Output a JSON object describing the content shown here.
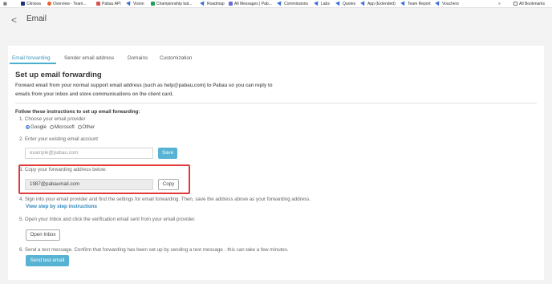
{
  "bookmarks": {
    "items": [
      {
        "label": "Clinicea",
        "icon": "clinicea-icon",
        "color": "#1e2f75"
      },
      {
        "label": "Overview - Team...",
        "icon": "overview-icon",
        "color": "#e8632b"
      },
      {
        "label": "Pabau API",
        "icon": "api-icon",
        "color": "#d9534f"
      },
      {
        "label": "Vision",
        "icon": "pin-icon",
        "color": "#3b6fd8"
      },
      {
        "label": "Championship bat...",
        "icon": "sheet-icon",
        "color": "#1e9e57"
      },
      {
        "label": "Roadmap",
        "icon": "pin-icon",
        "color": "#3b6fd8"
      },
      {
        "label": "All Messages | Pab...",
        "icon": "messages-icon",
        "color": "#6b6bd6"
      },
      {
        "label": "Commissions",
        "icon": "pin-icon",
        "color": "#3b6fd8"
      },
      {
        "label": "Labs",
        "icon": "pin-icon",
        "color": "#3b6fd8"
      },
      {
        "label": "Quotes",
        "icon": "pin-icon",
        "color": "#3b6fd8"
      },
      {
        "label": "App (Extended)",
        "icon": "pin-icon",
        "color": "#3b6fd8"
      },
      {
        "label": "Team Report",
        "icon": "pin-icon",
        "color": "#3b6fd8"
      },
      {
        "label": "Vouchers",
        "icon": "pin-icon",
        "color": "#3b6fd8"
      }
    ],
    "more_label": "»",
    "all_bookmarks_label": "All Bookmarks"
  },
  "header": {
    "back_glyph": "<",
    "title": "Email"
  },
  "tabs": [
    {
      "label": "Email forwarding",
      "active": true
    },
    {
      "label": "Sender email address",
      "active": false
    },
    {
      "label": "Domains",
      "active": false
    },
    {
      "label": "Customization",
      "active": false
    }
  ],
  "section": {
    "title": "Set up email forwarding",
    "intro_line1": "Forward email from your normal support email address (such as help@pabau.com) to Pabau so you can reply to",
    "intro_line2": "emails from your inbox and store communications on the client card."
  },
  "instructions": {
    "title": "Follow these instructions to set up email forwarding:",
    "step1": "1. Choose your email provider",
    "providers": [
      {
        "label": "Google",
        "selected": true
      },
      {
        "label": "Microsoft",
        "selected": false
      },
      {
        "label": "Other",
        "selected": false
      }
    ],
    "step2": "2. Enter your existing email account",
    "email_placeholder": "example@pabau.com",
    "save_label": "Save",
    "step3": "3. Copy your forwarding address below:",
    "forwarding_address": "1987@pabaumail.com",
    "copy_label": "Copy",
    "step4": "4. Sign into your email provider and find the settings for email forwarding. Then, save the address above as your forwarding address.",
    "step4_link": "View step by step instructions",
    "step5": "5. Open your Inbox and click the verification email sent from your email provider.",
    "open_inbox_label": "Open Inbox",
    "step6": "6. Send a test message. Confirm that forwarding has been set up by sending a test message - this can take a few minutes.",
    "send_test_label": "Send test email"
  },
  "colors": {
    "accent": "#56b3d4",
    "active_tab": "#3a93b9",
    "highlight_border": "#e23a3a",
    "link": "#2f86b9"
  }
}
